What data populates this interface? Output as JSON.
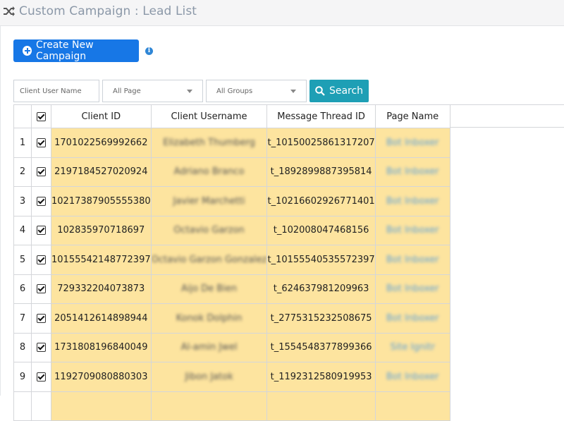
{
  "header": {
    "title": "Custom Campaign : Lead List",
    "icon": "shuffle-icon"
  },
  "toolbar": {
    "create_label": "Create New Campaign",
    "info_icon": "info-icon"
  },
  "filters": {
    "client_user_name_placeholder": "Client User Name",
    "page_select": "All Page",
    "groups_select": "All Groups",
    "search_label": "Search"
  },
  "table": {
    "columns": [
      "",
      "",
      "Client ID",
      "Client Username",
      "Message Thread ID",
      "Page Name"
    ],
    "rows": [
      {
        "n": "1",
        "client_id": "1701022569992662",
        "username": "Elizabeth Thumberg",
        "thread": "t_10150025861317207",
        "page": "Bot Inboxer",
        "checked": true
      },
      {
        "n": "2",
        "client_id": "2197184527020924",
        "username": "Adriano Branco",
        "thread": "t_1892899887395814",
        "page": "Bot Inboxer",
        "checked": true
      },
      {
        "n": "3",
        "client_id": "10217387905555380",
        "username": "Javier Marchetti",
        "thread": "t_10216602926771401",
        "page": "Bot Inboxer",
        "checked": true
      },
      {
        "n": "4",
        "client_id": "102835970718697",
        "username": "Octavio Garzon",
        "thread": "t_102008047468156",
        "page": "Bot Inboxer",
        "checked": true
      },
      {
        "n": "5",
        "client_id": "10155542148772397",
        "username": "Octavio Garzon Gonzalez",
        "thread": "t_10155540535572397",
        "page": "Bot Inboxer",
        "checked": true
      },
      {
        "n": "6",
        "client_id": "729332204073873",
        "username": "Aijo De Bien",
        "thread": "t_624637981209963",
        "page": "Bot Inboxer",
        "checked": true
      },
      {
        "n": "7",
        "client_id": "2051412614898944",
        "username": "Konok Dolphin",
        "thread": "t_2775315232508675",
        "page": "Bot Inboxer",
        "checked": true
      },
      {
        "n": "8",
        "client_id": "1731808196840049",
        "username": "Al-amin Jwel",
        "thread": "t_1554548377899366",
        "page": "Site Ignitr",
        "checked": true
      },
      {
        "n": "9",
        "client_id": "1192709080880303",
        "username": "Jibon Jatok",
        "thread": "t_1192312580919953",
        "page": "Bot Inboxer",
        "checked": true
      }
    ]
  },
  "colors": {
    "primary": "#1777e6",
    "search": "#1e9fb5",
    "highlight": "#fde49f",
    "title": "#8b98a8"
  }
}
